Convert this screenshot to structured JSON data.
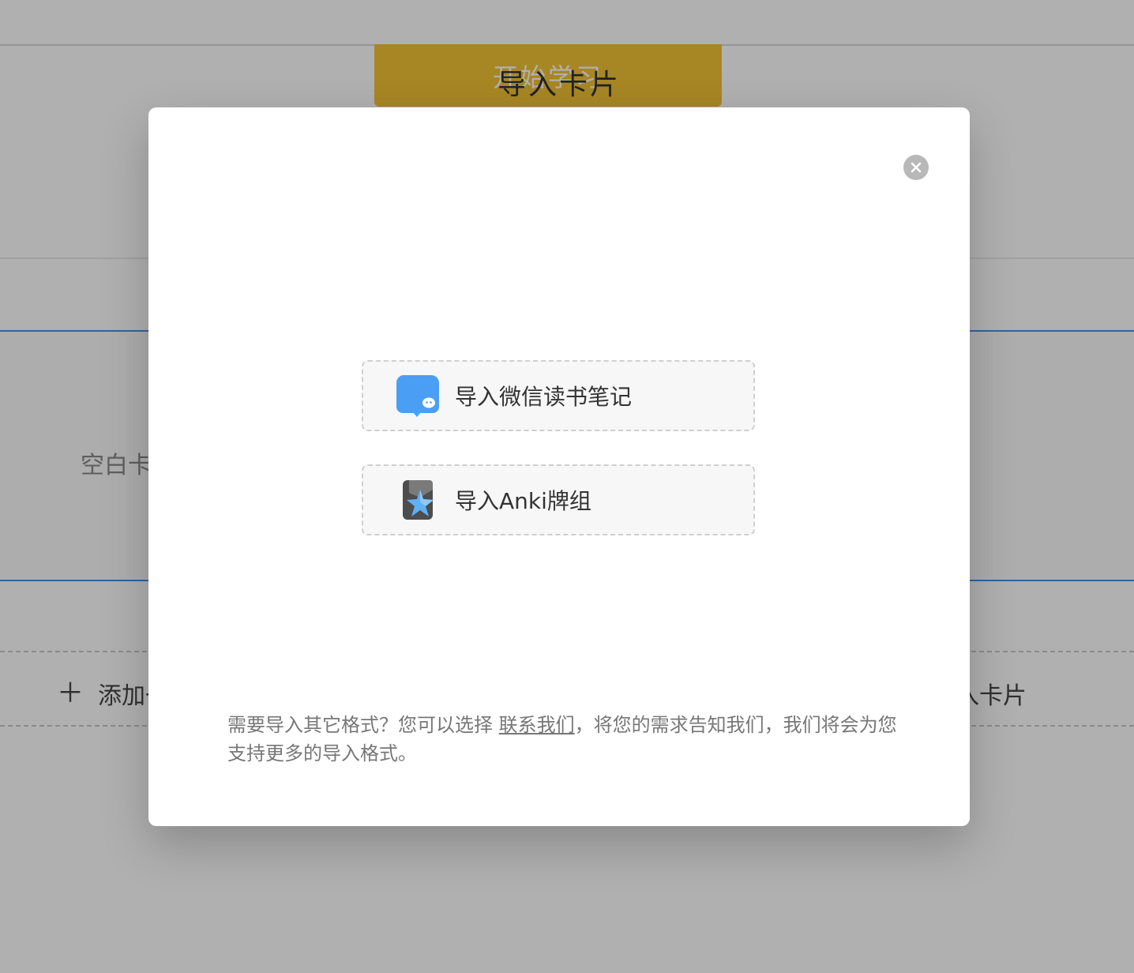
{
  "background": {
    "start_button": "开始学习",
    "blank_card_label": "空白卡",
    "add_button_label": "添加一",
    "import_right_label": "入卡片"
  },
  "modal": {
    "title": "导入卡片",
    "close_icon": "close-icon",
    "options": [
      {
        "label": "导入微信读书笔记",
        "icon": "weread-icon",
        "icon_color": "#4a9ff5"
      },
      {
        "label": "导入Anki牌组",
        "icon": "anki-icon",
        "icon_color": "#4a9ff5"
      }
    ],
    "footnote": {
      "before": "需要导入其它格式？您可以选择 ",
      "link": "联系我们",
      "after": "，将您的需求告知我们，我们将会为您支持更多的导入格式。"
    }
  },
  "colors": {
    "accent_yellow": "#f2c335",
    "accent_blue": "#4a90e2",
    "overlay": "rgba(0,0,0,0.31)"
  }
}
